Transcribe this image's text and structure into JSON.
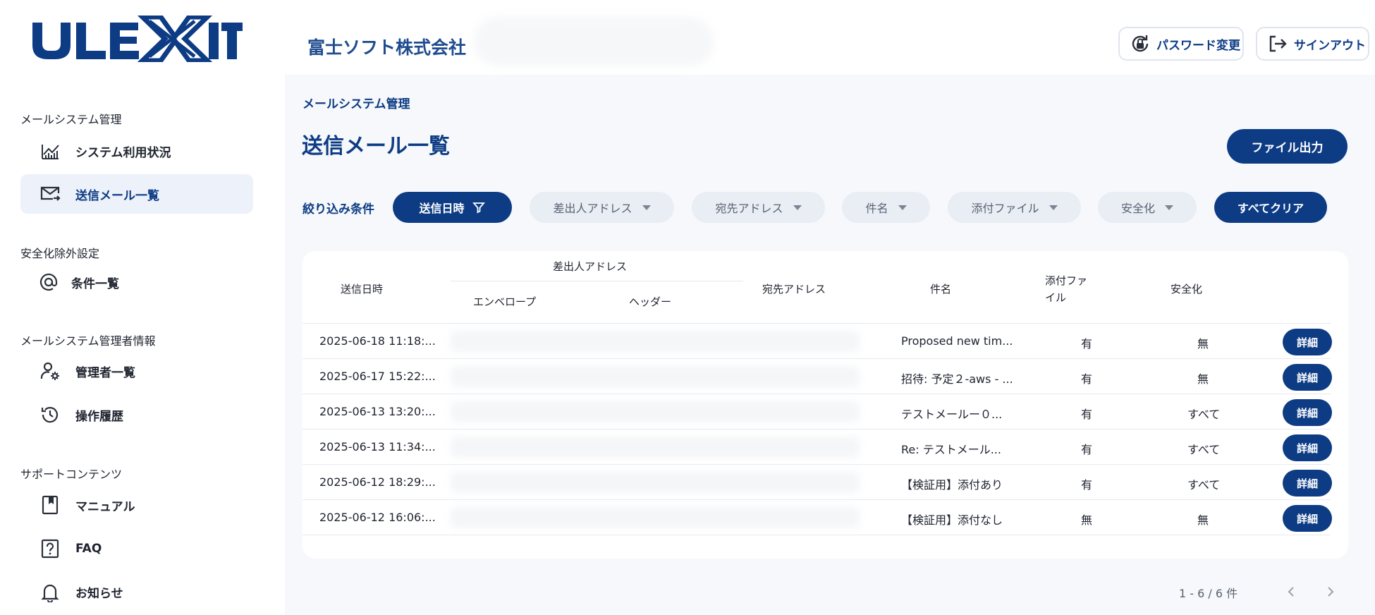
{
  "header": {
    "logo_text": "ULEXIT",
    "company": "富士ソフト株式会社",
    "password_btn": "パスワード変更",
    "signout_btn": "サインアウト"
  },
  "sidebar": {
    "sections": [
      {
        "label": "メールシステム管理",
        "items": [
          {
            "label": "システム利用状況",
            "icon": "chart-icon"
          },
          {
            "label": "送信メール一覧",
            "icon": "mail-send-icon",
            "active": true
          }
        ]
      },
      {
        "label": "安全化除外設定",
        "items": [
          {
            "label": "条件一覧",
            "icon": "at-icon"
          }
        ]
      },
      {
        "label": "メールシステム管理者情報",
        "items": [
          {
            "label": "管理者一覧",
            "icon": "user-gear-icon"
          },
          {
            "label": "操作履歴",
            "icon": "history-icon"
          }
        ]
      },
      {
        "label": "サポートコンテンツ",
        "items": [
          {
            "label": "マニュアル",
            "icon": "book-icon"
          },
          {
            "label": "FAQ",
            "icon": "question-icon"
          },
          {
            "label": "お知らせ",
            "icon": "bell-icon"
          }
        ]
      }
    ]
  },
  "main": {
    "breadcrumb": "メールシステム管理",
    "title": "送信メール一覧",
    "export_btn": "ファイル出力",
    "filter_label": "絞り込み条件",
    "filters": [
      "送信日時",
      "差出人アドレス",
      "宛先アドレス",
      "件名",
      "添付ファイル",
      "安全化"
    ],
    "clear_btn": "すべてクリア",
    "table": {
      "headers": {
        "sent_at": "送信日時",
        "sender": "差出人アドレス",
        "envelope": "エンベロープ",
        "header": "ヘッダー",
        "to": "宛先アドレス",
        "subject": "件名",
        "attach_line1": "添付ファ",
        "attach_line2": "イル",
        "sanitize": "安全化"
      },
      "rows": [
        {
          "sent_at": "2025-06-18 11:18:...",
          "subject": "Proposed new tim...",
          "attach": "有",
          "sanitize": "無",
          "action": "詳細"
        },
        {
          "sent_at": "2025-06-17 15:22:...",
          "subject": "招待: 予定２-aws - ...",
          "attach": "有",
          "sanitize": "無",
          "action": "詳細"
        },
        {
          "sent_at": "2025-06-13 13:20:...",
          "subject": "テストメールー０...",
          "attach": "有",
          "sanitize": "すべて",
          "action": "詳細"
        },
        {
          "sent_at": "2025-06-13 11:34:...",
          "subject": "Re: テストメール...",
          "attach": "有",
          "sanitize": "すべて",
          "action": "詳細"
        },
        {
          "sent_at": "2025-06-12 18:29:...",
          "subject": "【検証用】添付あり",
          "attach": "有",
          "sanitize": "すべて",
          "action": "詳細"
        },
        {
          "sent_at": "2025-06-12 16:06:...",
          "subject": "【検証用】添付なし",
          "attach": "無",
          "sanitize": "無",
          "action": "詳細"
        }
      ]
    },
    "pagination": "1 - 6 / 6 件"
  },
  "colors": {
    "primary": "#0d3c85",
    "active_bg": "#edf1f9",
    "main_bg": "#f6f8fb",
    "chip_bg": "#e9edf4"
  }
}
